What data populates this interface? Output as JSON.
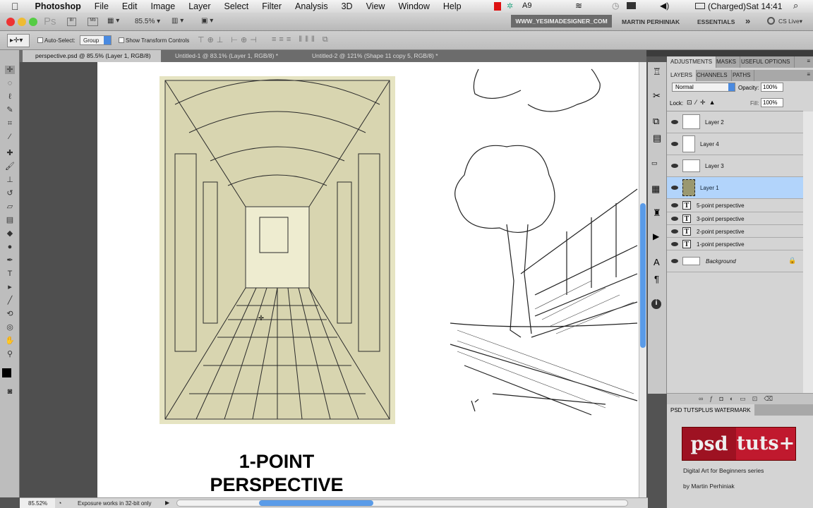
{
  "menubar": {
    "app": "Photoshop",
    "items": [
      "File",
      "Edit",
      "Image",
      "Layer",
      "Select",
      "Filter",
      "Analysis",
      "3D",
      "View",
      "Window",
      "Help"
    ],
    "battery": "(Charged)",
    "clock": "Sat 14:41",
    "adobe_count": "9"
  },
  "appbar": {
    "ps": "Ps",
    "br": "Br",
    "mb": "Mb",
    "zoom": "85.5%",
    "workspace_active": "WWW_YESIMADESIGNER_COM",
    "workspace2": "MARTIN PERHINIAK",
    "workspace3": "ESSENTIALS",
    "more": "»",
    "cslive": "CS Live"
  },
  "options": {
    "auto_select": "Auto-Select:",
    "group": "Group",
    "show_transform": "Show Transform Controls"
  },
  "tabs": [
    "perspective.psd @ 85.5% (Layer 1, RGB/8)",
    "Untitled-1 @ 83.1% (Layer 1, RGB/8) *",
    "Untitled-2 @ 121% (Shape 11 copy 5, RGB/8) *"
  ],
  "canvas": {
    "caption1": "1-POINT",
    "caption2": "PERSPECTIVE"
  },
  "status": {
    "zoom": "85.52%",
    "message": "Exposure works in 32-bit only"
  },
  "panel": {
    "top_tabs": [
      "ADJUSTMENTS",
      "MASKS",
      "USEFUL OPTIONS"
    ],
    "layer_tabs": [
      "LAYERS",
      "CHANNELS",
      "PATHS"
    ],
    "blend": "Normal",
    "opacity_label": "Opacity:",
    "opacity": "100%",
    "lock_label": "Lock:",
    "fill_label": "Fill:",
    "fill": "100%",
    "layers": [
      {
        "name": "Layer 2"
      },
      {
        "name": "Layer 4"
      },
      {
        "name": "Layer 3"
      },
      {
        "name": "Layer 1",
        "selected": true
      },
      {
        "name": "5-point perspective",
        "type": "text"
      },
      {
        "name": "3-point perspective",
        "type": "text"
      },
      {
        "name": "2-point perspective",
        "type": "text"
      },
      {
        "name": "1-point perspective",
        "type": "text"
      },
      {
        "name": "Background",
        "locked": true
      }
    ]
  },
  "watermark": {
    "title": "PSD TUTSPLUS WATERMARK",
    "logo_left": "psd",
    "logo_right": "tuts+",
    "line1": "Digital Art for Beginners series",
    "line2": "by Martin Perhiniak"
  }
}
